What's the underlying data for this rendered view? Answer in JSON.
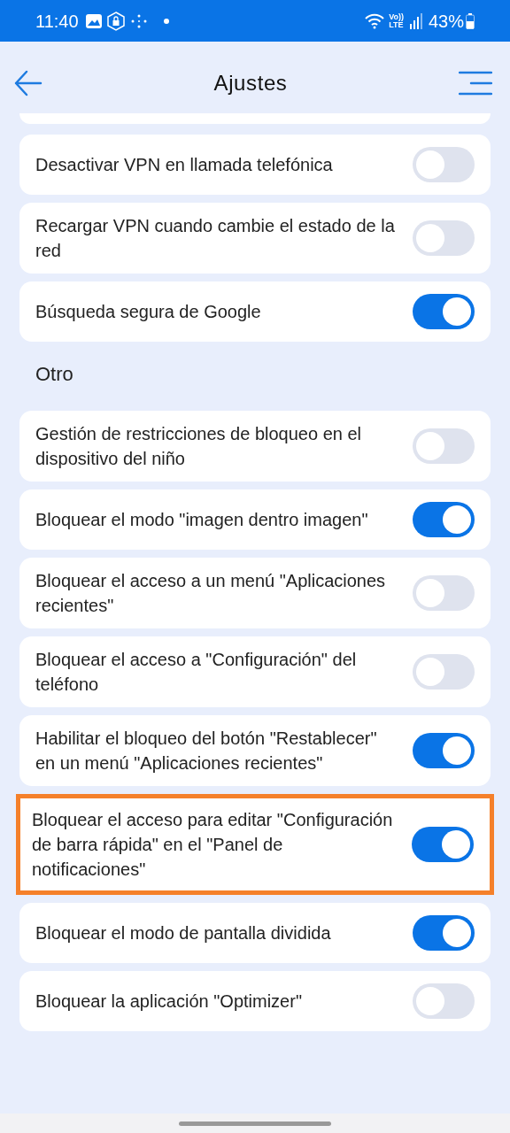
{
  "status_bar": {
    "time": "11:40",
    "network_top": "Vo))",
    "network_bottom": "LTE",
    "battery": "43%"
  },
  "header": {
    "title": "Ajustes"
  },
  "groups": [
    {
      "items": [
        {
          "label": "Desactivar VPN en llamada telefónica",
          "on": false,
          "highlighted": false
        },
        {
          "label": "Recargar VPN cuando cambie el estado de la red",
          "on": false,
          "highlighted": false
        },
        {
          "label": "Búsqueda segura de Google",
          "on": true,
          "highlighted": false
        }
      ]
    },
    {
      "title": "Otro",
      "items": [
        {
          "label": "Gestión de restricciones de bloqueo en el dispositivo del niño",
          "on": false,
          "highlighted": false
        },
        {
          "label": "Bloquear el modo \"imagen dentro imagen\"",
          "on": true,
          "highlighted": false
        },
        {
          "label": "Bloquear el acceso a un menú \"Aplicaciones recientes\"",
          "on": false,
          "highlighted": false
        },
        {
          "label": "Bloquear el acceso a \"Configuración\" del teléfono",
          "on": false,
          "highlighted": false
        },
        {
          "label": "Habilitar el bloqueo del botón \"Restablecer\" en un menú \"Aplicaciones recientes\"",
          "on": true,
          "highlighted": false
        },
        {
          "label": "Bloquear el acceso para editar \"Configuración de barra rápida\" en el \"Panel de notificaciones\"",
          "on": true,
          "highlighted": true
        },
        {
          "label": "Bloquear el modo de pantalla dividida",
          "on": true,
          "highlighted": false
        },
        {
          "label": "Bloquear la aplicación \"Optimizer\"",
          "on": false,
          "highlighted": false
        }
      ]
    }
  ]
}
